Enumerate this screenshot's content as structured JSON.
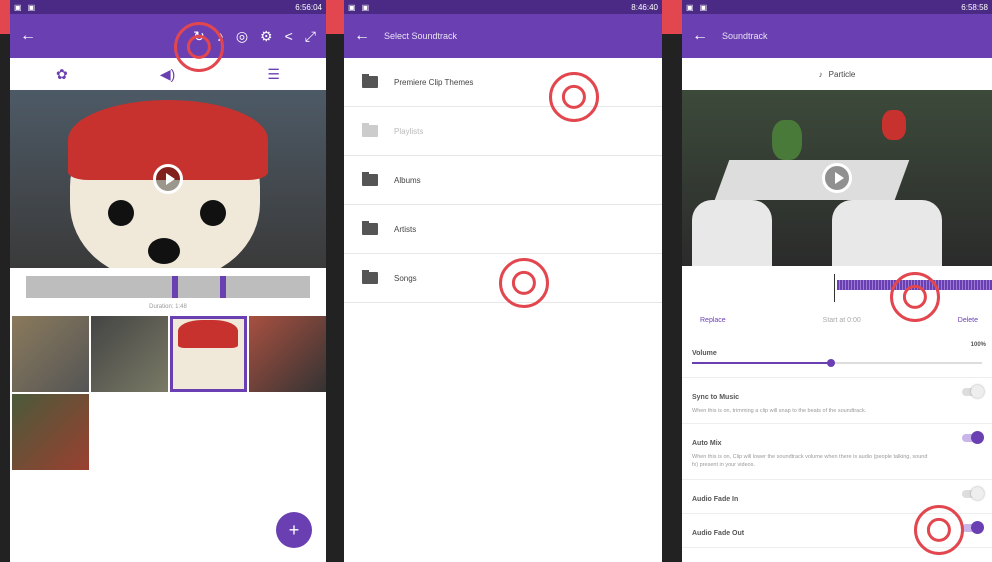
{
  "colors": {
    "accent": "#6a3fb2",
    "highlight": "#e2464e"
  },
  "screen1": {
    "status_time": "6:56:04",
    "toolbar_icons": [
      "back-arrow-icon",
      "rotate-icon",
      "music-note-icon",
      "filter-icon",
      "gear-icon",
      "share-icon",
      "expand-icon"
    ],
    "tabs": [
      "gear-icon",
      "volume-icon",
      "menu-icon"
    ],
    "duration": "Duration: 1:48",
    "fab_label": "+"
  },
  "screen2": {
    "status_time": "8:46:40",
    "title": "Select Soundtrack",
    "folders": [
      {
        "label": "Premiere Clip Themes",
        "enabled": true
      },
      {
        "label": "Playlists",
        "enabled": false
      },
      {
        "label": "Albums",
        "enabled": true
      },
      {
        "label": "Artists",
        "enabled": true
      },
      {
        "label": "Songs",
        "enabled": true
      }
    ]
  },
  "screen3": {
    "status_time": "6:58:58",
    "title": "Soundtrack",
    "track_name": "Particle",
    "replace": "Replace",
    "start_at": "Start at 0:00",
    "delete": "Delete",
    "volume_label": "Volume",
    "volume_value": "100%",
    "volume_level": 0.48,
    "settings": [
      {
        "label": "Sync to Music",
        "desc": "When this is on, trimming a clip will snap to the beats of the soundtrack.",
        "on": false
      },
      {
        "label": "Auto Mix",
        "desc": "When this is on, Clip will lower the soundtrack volume when there is audio (people talking, sound fx) present in your videos.",
        "on": true
      },
      {
        "label": "Audio Fade In",
        "desc": "",
        "on": false
      },
      {
        "label": "Audio Fade Out",
        "desc": "",
        "on": true
      }
    ]
  }
}
